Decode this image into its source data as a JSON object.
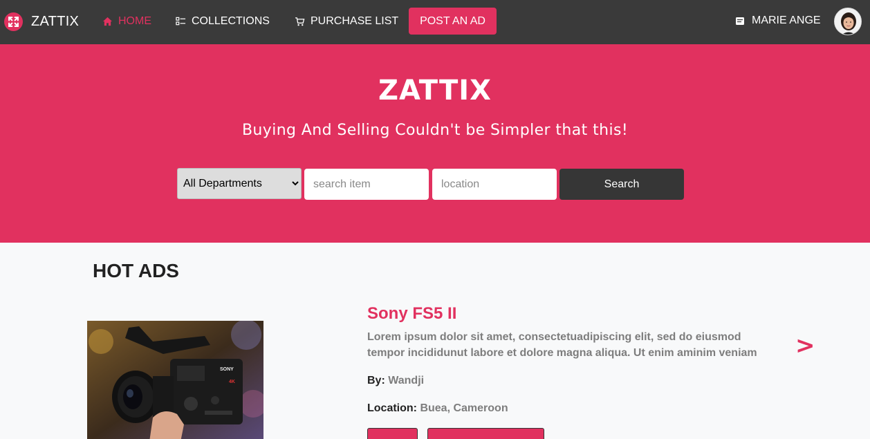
{
  "nav": {
    "brand": "ZATTIX",
    "items": [
      {
        "label": "HOME"
      },
      {
        "label": "COLLECTIONS"
      },
      {
        "label": "PURCHASE LIST"
      }
    ],
    "post_ad": "POST AN AD",
    "user_name": "MARIE ANGE"
  },
  "hero": {
    "title": "ZATTIX",
    "subtitle": "Buying And Selling Couldn't be Simpler that this!",
    "department_selected": "All Departments",
    "search_placeholder": "search item",
    "location_placeholder": "location",
    "search_button": "Search"
  },
  "hot_ads": {
    "title": "HOT ADS",
    "ad": {
      "title": "Sony FS5 II",
      "description": "Lorem ipsum dolor sit amet, consectetuadipiscing elit, sed do eiusmod tempor incididunut labore et dolore magna aliqua. Ut enim aminim veniam",
      "by_label": "By",
      "by_value": "Wandji",
      "location_label": "Location",
      "location_value": "Buea, Cameroon"
    },
    "next_arrow": ">"
  },
  "colors": {
    "brand": "#e1315f",
    "navbar": "#3a3a3a",
    "button_dark": "#363636"
  },
  "icons": [
    "logo-icon",
    "home-icon",
    "collections-icon",
    "cart-icon",
    "user-card-icon"
  ]
}
